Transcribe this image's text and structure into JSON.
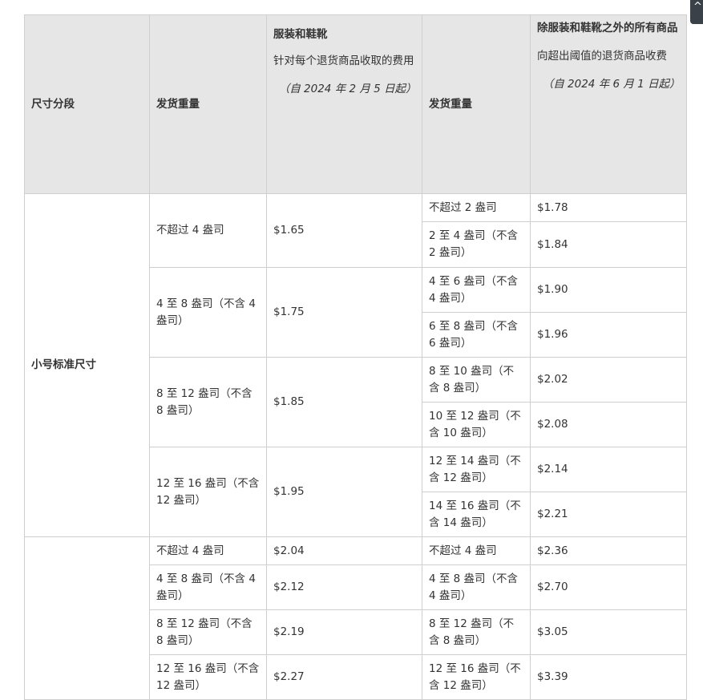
{
  "header": {
    "size_tier": "尺寸分段",
    "shipping_weight_1": "发货重量",
    "apparel_title": "服装和鞋靴",
    "apparel_desc": "针对每个退货商品收取的费用",
    "apparel_note": "（自 2024 年 2 月 5 日起）",
    "shipping_weight_2": "发货重量",
    "other_title": "除服装和鞋靴之外的所有商品",
    "other_desc": "向超出阈值的退货商品收费",
    "other_note": "（自 2024 年 6 月 1 日起）"
  },
  "small_standard": {
    "tier": "小号标准尺寸",
    "groups": [
      {
        "weight": "不超过 4 盎司",
        "apparel_fee": "$1.65",
        "sub": [
          {
            "weight": "不超过 2 盎司",
            "fee": "$1.78"
          },
          {
            "weight": "2 至 4 盎司（不含 2 盎司）",
            "fee": "$1.84"
          }
        ]
      },
      {
        "weight": "4 至 8 盎司（不含 4 盎司）",
        "apparel_fee": "$1.75",
        "sub": [
          {
            "weight": "4 至 6 盎司（不含 4 盎司）",
            "fee": "$1.90"
          },
          {
            "weight": "6 至 8 盎司（不含 6 盎司）",
            "fee": "$1.96"
          }
        ]
      },
      {
        "weight": "8 至 12 盎司（不含 8 盎司）",
        "apparel_fee": "$1.85",
        "sub": [
          {
            "weight": "8 至 10 盎司（不含 8 盎司）",
            "fee": "$2.02"
          },
          {
            "weight": "10 至 12 盎司（不含 10 盎司）",
            "fee": "$2.08"
          }
        ]
      },
      {
        "weight": "12 至 16 盎司（不含 12 盎司）",
        "apparel_fee": "$1.95",
        "sub": [
          {
            "weight": "12 至 14 盎司（不含 12 盎司）",
            "fee": "$2.14"
          },
          {
            "weight": "14 至 16 盎司（不含 14 盎司）",
            "fee": "$2.21"
          }
        ]
      }
    ]
  },
  "next_tier": {
    "rows": [
      {
        "weight": "不超过 4 盎司",
        "apparel_fee": "$2.04",
        "weight2": "不超过 4 盎司",
        "fee": "$2.36"
      },
      {
        "weight": "4 至 8 盎司（不含 4 盎司）",
        "apparel_fee": "$2.12",
        "weight2": "4 至 8 盎司（不含 4 盎司）",
        "fee": "$2.70"
      },
      {
        "weight": "8 至 12 盎司（不含 8 盎司）",
        "apparel_fee": "$2.19",
        "weight2": "8 至 12 盎司（不含 8 盎司）",
        "fee": "$3.05"
      },
      {
        "weight": "12 至 16 盎司（不含 12 盎司）",
        "apparel_fee": "$2.27",
        "weight2": "12 至 16 盎司（不含 12 盎司）",
        "fee": "$3.39"
      }
    ]
  }
}
